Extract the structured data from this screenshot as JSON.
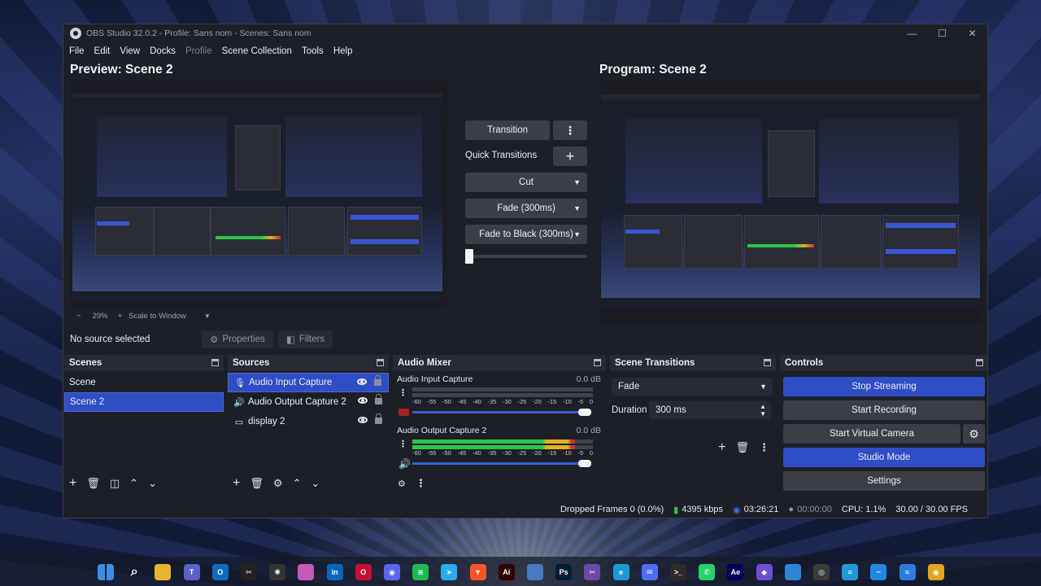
{
  "window": {
    "title": "OBS Studio 32.0.2 - Profile: Sans nom - Scenes: Sans nom"
  },
  "window_controls": {
    "minimize": "—",
    "maximize": "☐",
    "close": "✕"
  },
  "menu": [
    "File",
    "Edit",
    "View",
    "Docks",
    "Profile",
    "Scene Collection",
    "Tools",
    "Help"
  ],
  "preview": {
    "label": "Preview: Scene 2",
    "zoom": "29%",
    "zoom_minus": "−",
    "zoom_plus": "+",
    "scale_mode": "Scale to Window"
  },
  "program": {
    "label": "Program: Scene 2"
  },
  "transitions_panel": {
    "transition_button": "Transition",
    "quick_transitions_label": "Quick Transitions",
    "items": [
      "Cut",
      "Fade (300ms)",
      "Fade to Black (300ms)"
    ],
    "tbar_level": 0
  },
  "source_toolbar": {
    "no_source": "No source selected",
    "properties": "Properties",
    "filters": "Filters"
  },
  "scenes": {
    "title": "Scenes",
    "items": [
      "Scene",
      "Scene 2"
    ],
    "selected_index": 1
  },
  "sources": {
    "title": "Sources",
    "items": [
      "Audio Input Capture",
      "Audio Output Capture 2",
      "display 2"
    ],
    "selected_index": 0
  },
  "audio_mixer": {
    "title": "Audio Mixer",
    "ticks": [
      "-60",
      "-55",
      "-50",
      "-45",
      "-40",
      "-35",
      "-30",
      "-25",
      "-20",
      "-15",
      "-10",
      "-5",
      "0"
    ],
    "channels": [
      {
        "name": "Audio Input Capture",
        "db": "0.0 dB",
        "level_fraction": 0.0,
        "volume_fraction": 1.0,
        "muted": true
      },
      {
        "name": "Audio Output Capture 2",
        "db": "0.0 dB",
        "level_fraction": 0.9,
        "volume_fraction": 1.0,
        "muted": false
      }
    ]
  },
  "scene_transitions": {
    "title": "Scene Transitions",
    "selected": "Fade",
    "duration_label": "Duration",
    "duration_value": "300 ms"
  },
  "controls": {
    "title": "Controls",
    "buttons": [
      "Stop Streaming",
      "Start Recording",
      "Start Virtual Camera",
      "Studio Mode",
      "Settings"
    ],
    "active": [
      "Stop Streaming",
      "Studio Mode"
    ]
  },
  "status": {
    "dropped_frames": "Dropped Frames 0 (0.0%)",
    "bitrate": "4395 kbps",
    "stream_time": "03:26:21",
    "record_time": "00:00:00",
    "cpu": "CPU: 1.1%",
    "fps": "30.00 / 30.00 FPS"
  },
  "colors": {
    "accent": "#2f4dc4",
    "panel": "#1d1f26",
    "meter_green": "#2ec44a",
    "meter_yellow": "#e0b325",
    "meter_red": "#c9322f"
  },
  "taskbar": {
    "icons": [
      {
        "name": "windows-start-icon",
        "glyph": "",
        "color": "#3a8ee8"
      },
      {
        "name": "search-icon",
        "glyph": "⌕",
        "color": "transparent"
      },
      {
        "name": "file-explorer-icon",
        "glyph": "",
        "color": "#e8b52e"
      },
      {
        "name": "teams-icon",
        "glyph": "T",
        "color": "#5b5fc7"
      },
      {
        "name": "outlook-icon",
        "glyph": "O",
        "color": "#0f6cbd"
      },
      {
        "name": "capcut-icon",
        "glyph": "✂",
        "color": "#222"
      },
      {
        "name": "chatgpt-icon",
        "glyph": "✺",
        "color": "#333"
      },
      {
        "name": "copilot-icon",
        "glyph": "",
        "color": "#c45ab8"
      },
      {
        "name": "linkedin-icon",
        "glyph": "in",
        "color": "#0a66c2"
      },
      {
        "name": "opera-icon",
        "glyph": "O",
        "color": "#c8102e"
      },
      {
        "name": "discord-icon",
        "glyph": "◉",
        "color": "#5865f2"
      },
      {
        "name": "spotify-icon",
        "glyph": "≋",
        "color": "#1db954"
      },
      {
        "name": "telegram-icon",
        "glyph": "➤",
        "color": "#2aabee"
      },
      {
        "name": "brave-icon",
        "glyph": "▼",
        "color": "#fb542b"
      },
      {
        "name": "illustrator-icon",
        "glyph": "Ai",
        "color": "#330000"
      },
      {
        "name": "app-icon",
        "glyph": "",
        "color": "#4a78c2"
      },
      {
        "name": "photoshop-icon",
        "glyph": "Ps",
        "color": "#001e36"
      },
      {
        "name": "snipping-tool-icon",
        "glyph": "✂",
        "color": "#6b4aa8"
      },
      {
        "name": "edge-icon",
        "glyph": "e",
        "color": "#1a9ad6"
      },
      {
        "name": "messenger-icon",
        "glyph": "✉",
        "color": "#4b6cf7"
      },
      {
        "name": "terminal-icon",
        "glyph": ">_",
        "color": "#2b2b2b"
      },
      {
        "name": "whatsapp-icon",
        "glyph": "✆",
        "color": "#25d366"
      },
      {
        "name": "after-effects-icon",
        "glyph": "Ae",
        "color": "#00005b"
      },
      {
        "name": "app-icon",
        "glyph": "◆",
        "color": "#6e4ed6"
      },
      {
        "name": "app-icon",
        "glyph": "",
        "color": "#2b86d4"
      },
      {
        "name": "obs-icon",
        "glyph": "◎",
        "color": "#3b3b3b"
      },
      {
        "name": "notes-icon",
        "glyph": "≡",
        "color": "#1f9ad6"
      },
      {
        "name": "app-icon",
        "glyph": "~",
        "color": "#1e88e5"
      },
      {
        "name": "app-icon",
        "glyph": "≈",
        "color": "#2d7be0"
      },
      {
        "name": "chrome-icon",
        "glyph": "◉",
        "color": "#e0a41f"
      }
    ]
  }
}
